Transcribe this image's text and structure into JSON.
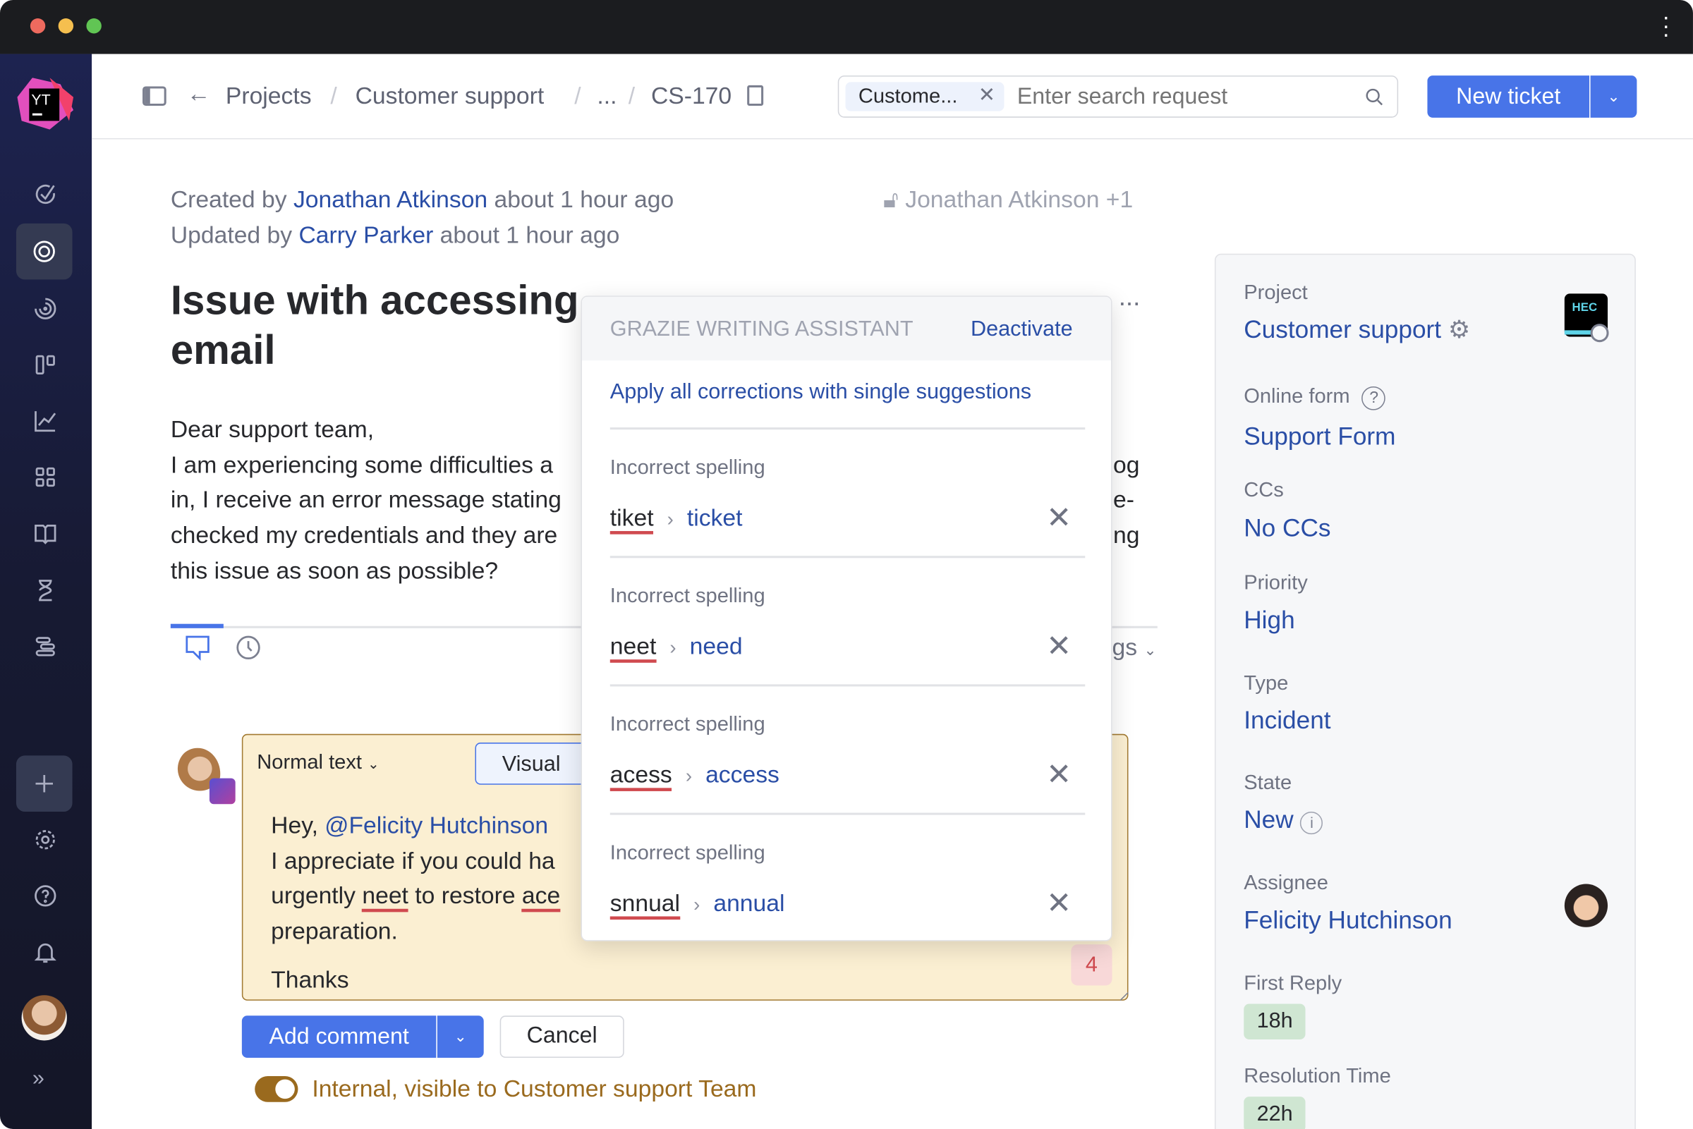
{
  "window": {
    "traffic_lights": [
      "#ee6a5e",
      "#f5bf4f",
      "#61c554"
    ],
    "menu_icon": "kebab-icon"
  },
  "sidebar": {
    "logo": "YT",
    "items": [
      "check-circle-icon",
      "lifebuoy-icon",
      "radar-icon",
      "board-icon",
      "chart-icon",
      "apps-icon",
      "book-icon",
      "hourglass-icon",
      "gantt-icon"
    ],
    "bottom": [
      "plus-icon",
      "gear-icon",
      "help-icon",
      "bell-icon",
      "avatar",
      "expand-icon"
    ]
  },
  "header": {
    "breadcrumb": [
      "Projects",
      "Customer support",
      "...",
      "CS-170"
    ],
    "search": {
      "chip": "Custome...",
      "placeholder": "Enter search request"
    },
    "new_ticket": "New ticket"
  },
  "ticket": {
    "created_prefix": "Created by",
    "created_by": "Jonathan Atkinson",
    "created_suffix": "about 1 hour ago",
    "updated_prefix": "Updated by",
    "updated_by": "Carry Parker",
    "updated_suffix": "about 1 hour ago",
    "visibility": "Jonathan Atkinson +1",
    "title_line1": "Issue with accessing",
    "title_line2": "email",
    "body_left": [
      "Dear support team,",
      "I am experiencing some difficulties a",
      "in, I receive an error message stating",
      "checked my credentials and they are",
      "this issue as soon as possible?"
    ],
    "body_right": [
      "",
      "og",
      "e-",
      "ng",
      ""
    ],
    "tabs_right": "gs",
    "more": "..."
  },
  "comment": {
    "format": "Normal text",
    "mode": "Visual",
    "greeting": "Hey,",
    "mention": "@Felicity Hutchinson",
    "line2": "I appreciate if you could ha",
    "line3_a": "urgently",
    "line3_err": "neet",
    "line3_b": "to restore",
    "line3_err2": "ace",
    "line4": "preparation.",
    "line5": "Thanks",
    "error_count": "4",
    "add": "Add comment",
    "cancel": "Cancel",
    "visibility": "Internal, visible to Customer support Team"
  },
  "assistant": {
    "title": "GRAZIE WRITING ASSISTANT",
    "deactivate": "Deactivate",
    "apply_all": "Apply all corrections with single suggestions",
    "items": [
      {
        "label": "Incorrect spelling",
        "wrong": "tiket",
        "fix": "ticket"
      },
      {
        "label": "Incorrect spelling",
        "wrong": "neet",
        "fix": "need"
      },
      {
        "label": "Incorrect spelling",
        "wrong": "acess",
        "fix": "access"
      },
      {
        "label": "Incorrect spelling",
        "wrong": "snnual",
        "fix": "annual"
      }
    ]
  },
  "fields": {
    "project_label": "Project",
    "project": "Customer support",
    "project_logo": "HEC",
    "form_label": "Online form",
    "form": "Support Form",
    "ccs_label": "CCs",
    "ccs": "No CCs",
    "priority_label": "Priority",
    "priority": "High",
    "type_label": "Type",
    "type": "Incident",
    "state_label": "State",
    "state": "New",
    "assignee_label": "Assignee",
    "assignee": "Felicity Hutchinson",
    "first_reply_label": "First Reply",
    "first_reply": "18h",
    "resolution_label": "Resolution Time",
    "resolution": "22h"
  }
}
